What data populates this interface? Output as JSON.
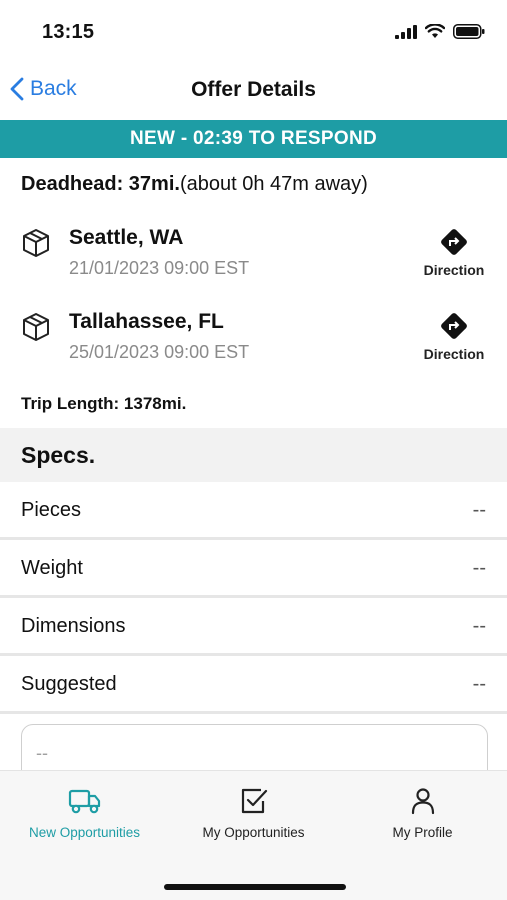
{
  "status_bar": {
    "time": "13:15"
  },
  "nav": {
    "back_label": "Back",
    "title": "Offer Details"
  },
  "banner": {
    "text": "NEW - 02:39 TO RESPOND",
    "color": "#1e9da5"
  },
  "deadhead": {
    "label": "Deadhead: 37mi.",
    "detail": "(about 0h 47m away)"
  },
  "stops": [
    {
      "city": "Seattle, WA",
      "datetime": "21/01/2023 09:00 EST",
      "direction_label": "Direction",
      "icon": "package-icon"
    },
    {
      "city": "Tallahassee, FL",
      "datetime": "25/01/2023 09:00 EST",
      "direction_label": "Direction",
      "icon": "package-icon"
    }
  ],
  "trip_length": "Trip Length: 1378mi.",
  "specs": {
    "title": "Specs.",
    "rows": [
      {
        "label": "Pieces",
        "value": "--"
      },
      {
        "label": "Weight",
        "value": "--"
      },
      {
        "label": "Dimensions",
        "value": "--"
      },
      {
        "label": "Suggested",
        "value": "--"
      }
    ]
  },
  "notes": {
    "value": "--"
  },
  "tabs": [
    {
      "label": "New Opportunities",
      "icon": "truck-icon",
      "active": true
    },
    {
      "label": "My Opportunities",
      "icon": "checkbox-icon",
      "active": false
    },
    {
      "label": "My Profile",
      "icon": "person-icon",
      "active": false
    }
  ],
  "colors": {
    "accent": "#1e9da5",
    "link": "#2a7de1"
  }
}
